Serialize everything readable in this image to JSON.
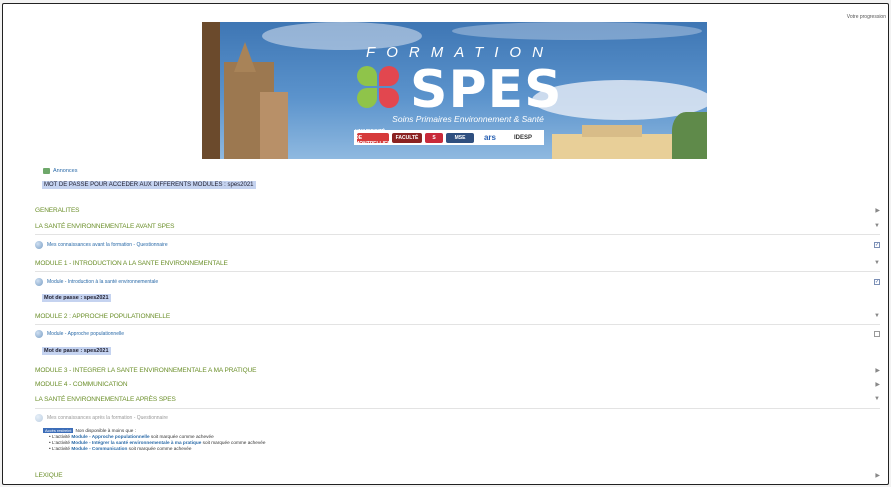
{
  "header": {
    "progress_label": "Votre progression"
  },
  "banner": {
    "formation": "FORMATION",
    "spes": "SPES",
    "subtitle": "Soins Primaires Environnement & Santé",
    "partner_logos": [
      "UNIVERSITÉ DE MONTPELLIER",
      "FACULTÉ",
      "S",
      "MSE",
      "ars",
      "IDESP"
    ]
  },
  "annonces": {
    "label": "Annonces"
  },
  "main_password": "MOT DE PASSE POUR ACCEDER AUX DIFFERENTS MODULES : spes2021",
  "sections": {
    "generalites": "GENERALITES",
    "avant": "LA SANTÉ ENVIRONNEMENTALE AVANT SPES",
    "module1": "MODULE 1 - INTRODUCTION A LA SANTE ENVIRONNEMENTALE",
    "module2": "MODULE 2 : APPROCHE POPULATIONNELLE",
    "module3": "MODULE 3 - INTEGRER LA SANTE ENVIRONNEMENTALE A MA PRATIQUE",
    "module4": "MODULE 4 - COMMUNICATION",
    "apres": "LA SANTÉ ENVIRONNEMENTALE APRÈS SPES",
    "lexique": "LEXIQUE"
  },
  "activities": {
    "avant": "Mes connaissances avant la formation - Questionnaire",
    "module1": "Module - Introduction à la santé environnementale",
    "module2": "Module - Approche populationnelle",
    "apres": "Mes connaissances après la formation - Questionnaire"
  },
  "passwords": {
    "module1": "Mot de passe : spes2021",
    "module2": "Mot de passe : spes2021"
  },
  "restriction": {
    "tag": "Accès restreint",
    "intro": "Non disponible à moins que :",
    "items": [
      {
        "prefix": "L'activité ",
        "link": "Module - Approche populationnelle",
        "suffix": " soit marquée comme achevée"
      },
      {
        "prefix": "L'activité ",
        "link": "Module - Intégrer la santé environnementale à ma pratique",
        "suffix": " soit marquée comme achevée"
      },
      {
        "prefix": "L'activité ",
        "link": "Module - Communication",
        "suffix": " soit marquée comme achevée"
      }
    ]
  },
  "completion": {
    "avant": true,
    "module1": true,
    "module2": false
  }
}
